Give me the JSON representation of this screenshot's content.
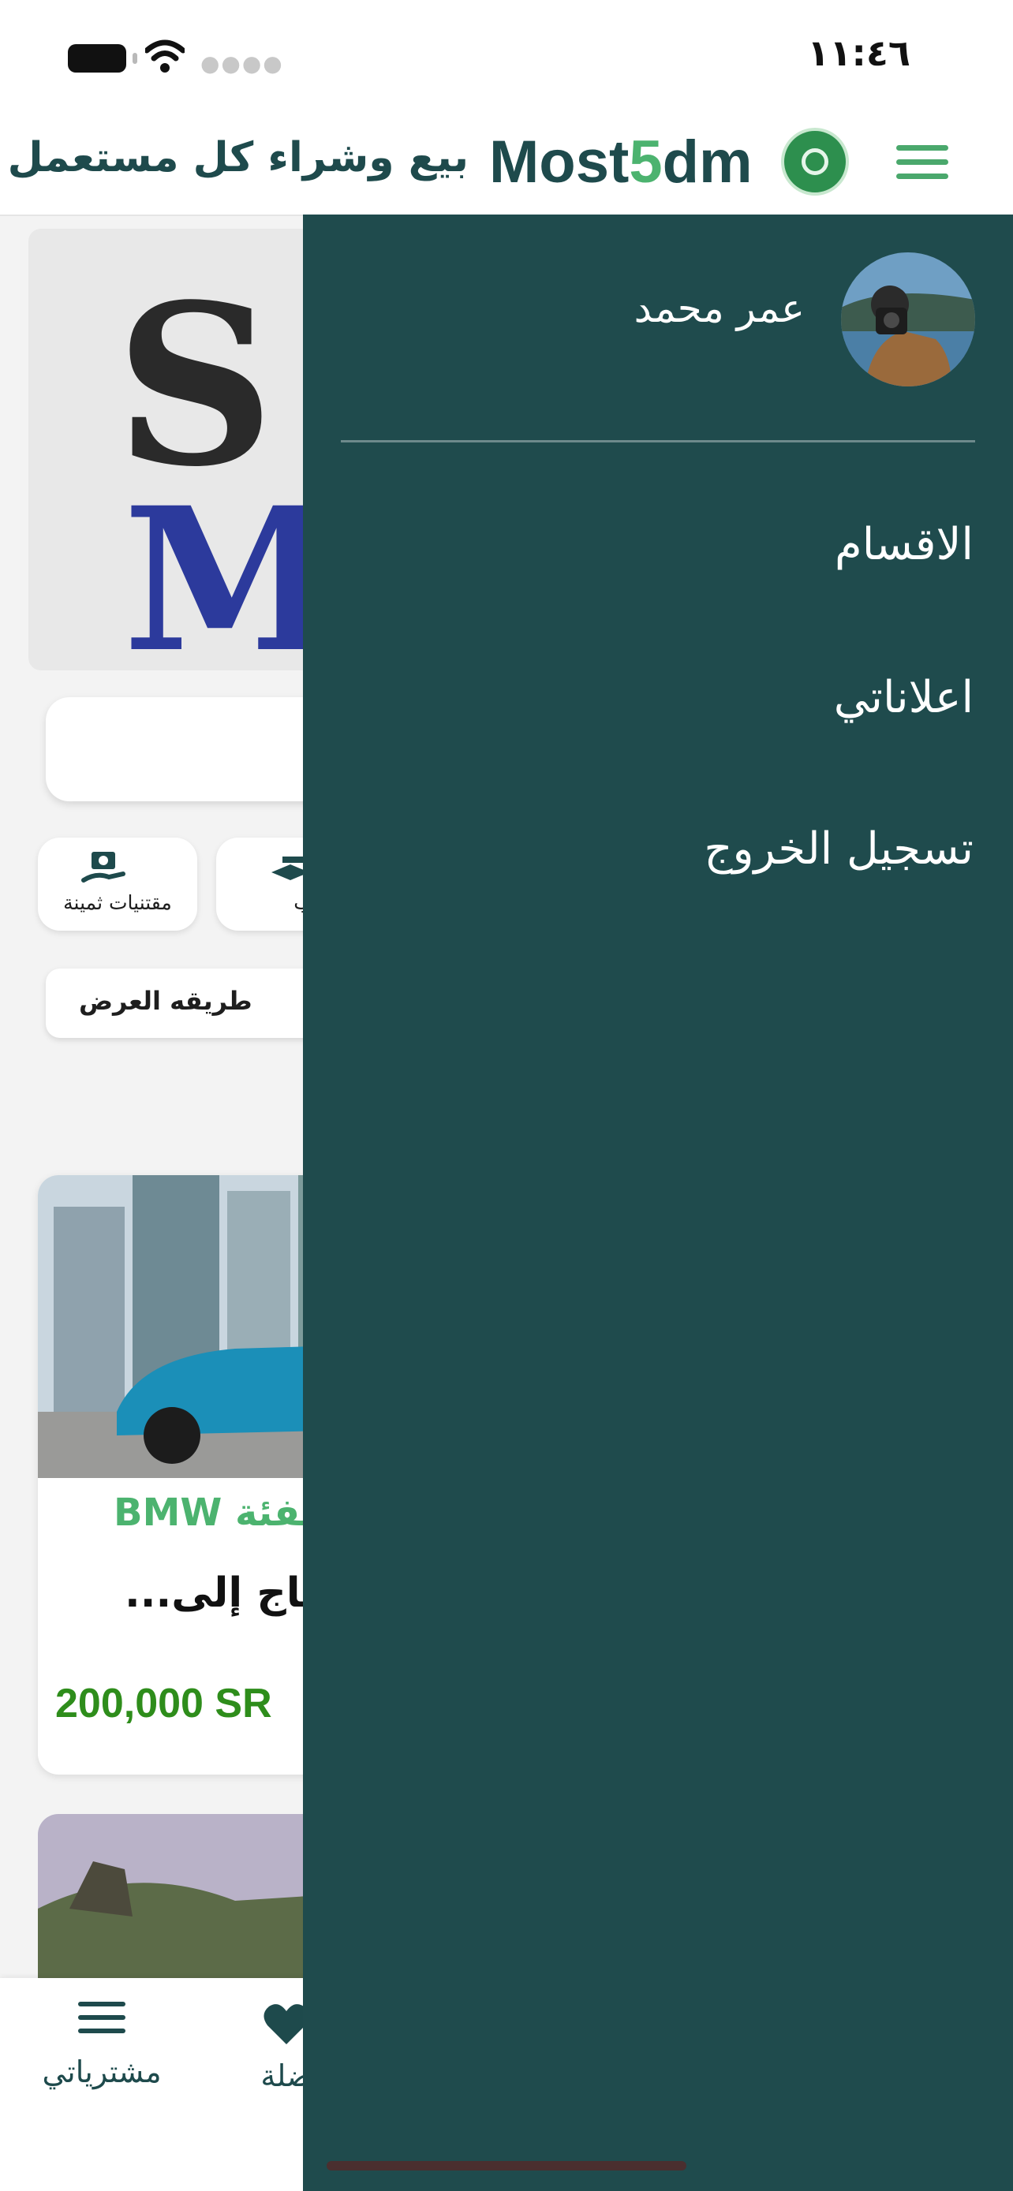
{
  "status_bar": {
    "time": "١١:٤٦"
  },
  "header": {
    "brand_part1": "Most",
    "brand_digit": "5",
    "brand_part2": "dm",
    "tagline": "بيع وشراء كل مستعمل"
  },
  "categories": [
    {
      "label": "مقتنيات ثمينة",
      "icon": "valuables-icon"
    },
    {
      "label": "ب",
      "icon": "category-icon"
    }
  ],
  "view_mode": {
    "label": "طريقه العرض"
  },
  "product": {
    "category": "الفئة BMW",
    "description": "حتاج إلى...",
    "price": "200,000 SR"
  },
  "bottom_nav": {
    "items": [
      {
        "label": "مشترياتي",
        "icon": "menu-icon"
      },
      {
        "label": "ضلة",
        "icon": "heart-icon"
      }
    ]
  },
  "drawer": {
    "user_name": "عمر محمد",
    "items": [
      {
        "label": "الاقسام"
      },
      {
        "label": "اعلاناتي"
      },
      {
        "label": "تسجيل الخروج"
      }
    ]
  },
  "colors": {
    "primary_dark": "#1f4b4d",
    "accent_green": "#4cb36f",
    "price_green": "#2e8d1b"
  }
}
